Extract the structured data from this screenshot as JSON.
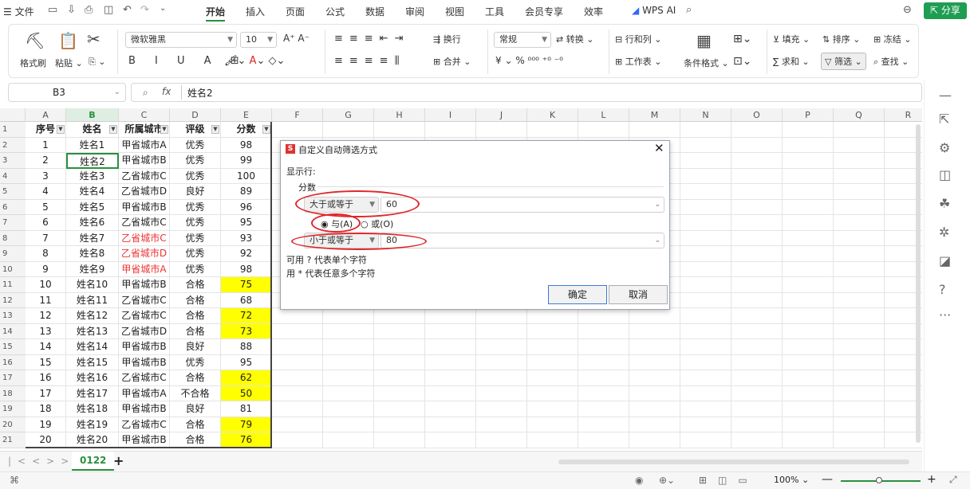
{
  "menubar": {
    "file": "文件",
    "tabs": [
      "开始",
      "插入",
      "页面",
      "公式",
      "数据",
      "审阅",
      "视图",
      "工具",
      "会员专享",
      "效率"
    ],
    "wps_ai": "WPS AI",
    "share": "分享"
  },
  "ribbon": {
    "format_painter": "格式刷",
    "paste": "粘贴",
    "font_name": "微软雅黑",
    "font_size": "10",
    "number_format": "常规",
    "convert": "转换",
    "wrap": "换行",
    "merge": "合并",
    "rows_cols": "行和列",
    "worksheet": "工作表",
    "cond_format": "条件格式",
    "fill": "填充",
    "sort": "排序",
    "freeze": "冻结",
    "sum": "求和",
    "filter": "筛选",
    "find": "查找",
    "currency": "¥",
    "percent": "%"
  },
  "formula_bar": {
    "cell_ref": "B3",
    "fx": "fx",
    "value": "姓名2"
  },
  "columns": [
    "A",
    "B",
    "C",
    "D",
    "E",
    "F",
    "G",
    "H",
    "I",
    "J",
    "K",
    "L",
    "M",
    "N",
    "O",
    "P",
    "Q",
    "R"
  ],
  "header_row": {
    "a": "序号",
    "b": "姓名",
    "c": "所属城市",
    "d": "评级",
    "e": "分数"
  },
  "rows": [
    {
      "n": "2",
      "a": "1",
      "b": "姓名1",
      "c": "甲省城市A",
      "d": "优秀",
      "e": "98",
      "cr": false,
      "ey": false
    },
    {
      "n": "3",
      "a": "2",
      "b": "姓名2",
      "c": "甲省城市B",
      "d": "优秀",
      "e": "99",
      "cr": false,
      "ey": false
    },
    {
      "n": "4",
      "a": "3",
      "b": "姓名3",
      "c": "乙省城市C",
      "d": "优秀",
      "e": "100",
      "cr": false,
      "ey": false
    },
    {
      "n": "5",
      "a": "4",
      "b": "姓名4",
      "c": "乙省城市D",
      "d": "良好",
      "e": "89",
      "cr": false,
      "ey": false
    },
    {
      "n": "6",
      "a": "5",
      "b": "姓名5",
      "c": "甲省城市B",
      "d": "优秀",
      "e": "96",
      "cr": false,
      "ey": false
    },
    {
      "n": "7",
      "a": "6",
      "b": "姓名6",
      "c": "乙省城市C",
      "d": "优秀",
      "e": "95",
      "cr": false,
      "ey": false
    },
    {
      "n": "8",
      "a": "7",
      "b": "姓名7",
      "c": "乙省城市C",
      "d": "优秀",
      "e": "93",
      "cr": true,
      "ey": false
    },
    {
      "n": "9",
      "a": "8",
      "b": "姓名8",
      "c": "乙省城市D",
      "d": "优秀",
      "e": "92",
      "cr": true,
      "ey": false
    },
    {
      "n": "10",
      "a": "9",
      "b": "姓名9",
      "c": "甲省城市A",
      "d": "优秀",
      "e": "98",
      "cr": true,
      "ey": false
    },
    {
      "n": "11",
      "a": "10",
      "b": "姓名10",
      "c": "甲省城市B",
      "d": "合格",
      "e": "75",
      "cr": false,
      "ey": true
    },
    {
      "n": "12",
      "a": "11",
      "b": "姓名11",
      "c": "乙省城市C",
      "d": "合格",
      "e": "68",
      "cr": false,
      "ey": false
    },
    {
      "n": "13",
      "a": "12",
      "b": "姓名12",
      "c": "乙省城市C",
      "d": "合格",
      "e": "72",
      "cr": false,
      "ey": true
    },
    {
      "n": "14",
      "a": "13",
      "b": "姓名13",
      "c": "乙省城市D",
      "d": "合格",
      "e": "73",
      "cr": false,
      "ey": true
    },
    {
      "n": "15",
      "a": "14",
      "b": "姓名14",
      "c": "甲省城市B",
      "d": "良好",
      "e": "88",
      "cr": false,
      "ey": false
    },
    {
      "n": "16",
      "a": "15",
      "b": "姓名15",
      "c": "甲省城市B",
      "d": "优秀",
      "e": "95",
      "cr": false,
      "ey": false
    },
    {
      "n": "17",
      "a": "16",
      "b": "姓名16",
      "c": "乙省城市C",
      "d": "合格",
      "e": "62",
      "cr": false,
      "ey": true
    },
    {
      "n": "18",
      "a": "17",
      "b": "姓名17",
      "c": "甲省城市A",
      "d": "不合格",
      "e": "50",
      "cr": false,
      "ey": true
    },
    {
      "n": "19",
      "a": "18",
      "b": "姓名18",
      "c": "甲省城市B",
      "d": "良好",
      "e": "81",
      "cr": false,
      "ey": false
    },
    {
      "n": "20",
      "a": "19",
      "b": "姓名19",
      "c": "乙省城市C",
      "d": "合格",
      "e": "79",
      "cr": false,
      "ey": true
    },
    {
      "n": "21",
      "a": "20",
      "b": "姓名20",
      "c": "甲省城市B",
      "d": "合格",
      "e": "76",
      "cr": false,
      "ey": true
    }
  ],
  "dialog": {
    "title": "自定义自动筛选方式",
    "show_rows": "显示行:",
    "field": "分数",
    "op1": "大于或等于",
    "val1": "60",
    "and_label": "与(A)",
    "or_label": "或(O)",
    "op2": "小于或等于",
    "val2": "80",
    "hint1": "可用 ? 代表单个字符",
    "hint2": "用 * 代表任意多个字符",
    "ok": "确定",
    "cancel": "取消"
  },
  "sheet": {
    "tab": "0122",
    "add": "+"
  },
  "status": {
    "zoom": "100%"
  },
  "colors": {
    "accent": "#2a8f3e",
    "highlight": "#ffff00",
    "annotation": "#e0262a"
  }
}
